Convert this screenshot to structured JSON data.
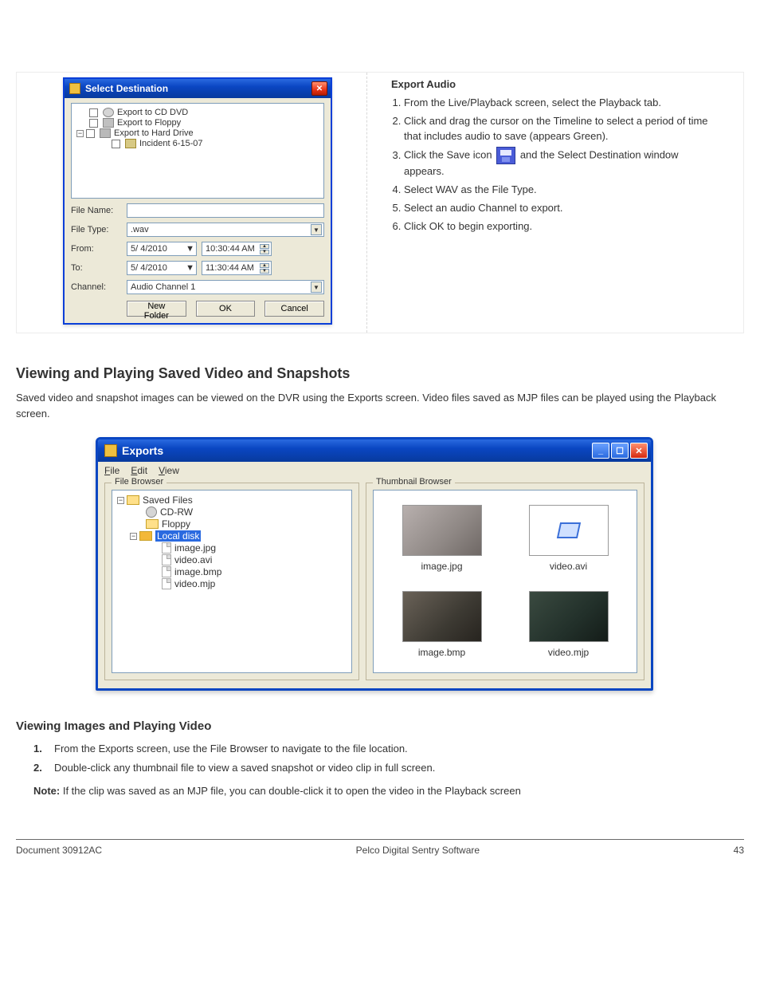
{
  "selectDestination": {
    "title": "Select Destination",
    "tree": {
      "cd": "Export to CD DVD",
      "floppy": "Export to Floppy",
      "hd": "Export to Hard Drive",
      "sub": "Incident 6-15-07"
    },
    "labels": {
      "fileName": "File Name:",
      "fileType": "File Type:",
      "from": "From:",
      "to": "To:",
      "channel": "Channel:"
    },
    "values": {
      "fileType": ".wav",
      "fromDate": "5/ 4/2010",
      "fromTime": "10:30:44 AM",
      "toDate": "5/ 4/2010",
      "toTime": "11:30:44 AM",
      "channel": "Audio Channel 1"
    },
    "buttons": {
      "newFolder": "New Folder",
      "ok": "OK",
      "cancel": "Cancel"
    }
  },
  "instructions": {
    "header": "Export Audio",
    "steps": [
      "From the Live/Playback screen, select the Playback tab.",
      "Click and drag the cursor on the Timeline to select a period of time that includes audio to save (appears Green).",
      "Click the Save icon",
      "Select WAV as the File Type.",
      "Select an audio Channel to export.",
      "Click OK to begin exporting."
    ],
    "iconSentenceTail": " and the Select Destination window appears."
  },
  "exportsSection": {
    "heading": "Viewing and Playing Saved Video and Snapshots",
    "intro": "Saved video and snapshot images can be viewed on the DVR using the Exports screen. Video files saved as MJP files can be played using the Playback screen.",
    "windowTitle": "Exports",
    "menus": {
      "file": "File",
      "edit": "Edit",
      "view": "View"
    },
    "fileBrowserLegend": "File Browser",
    "thumbBrowserLegend": "Thumbnail Browser",
    "tree": {
      "root": "Saved Files",
      "cdrw": "CD-RW",
      "floppy": "Floppy",
      "local": "Local disk",
      "files": [
        "image.jpg",
        "video.avi",
        "image.bmp",
        "video.mjp"
      ]
    },
    "thumbs": [
      "image.jpg",
      "video.avi",
      "image.bmp",
      "video.mjp"
    ]
  },
  "viewingImages": {
    "heading": "Viewing Images and Playing Video",
    "steps": [
      "From the Exports screen, use the File Browser to navigate to the file location.",
      "Double-click any thumbnail file to view a saved snapshot or video clip in full screen."
    ],
    "note": "If the clip was saved as an MJP file, you can double-click it to open the video in the Playback screen"
  },
  "footer": {
    "left": "Document 30912AC",
    "center": "Pelco Digital Sentry Software",
    "right": "43"
  }
}
